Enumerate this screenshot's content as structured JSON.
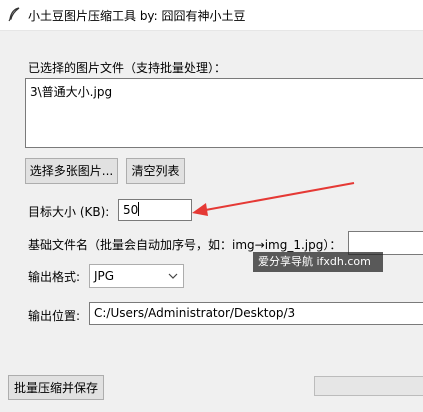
{
  "window": {
    "title": "小土豆图片压缩工具 by: 囧囧有神小土豆"
  },
  "files": {
    "label": "已选择的图片文件（支持批量处理）：",
    "items": [
      "3\\普通大小.jpg"
    ],
    "select_button": "选择多张图片...",
    "clear_button": "清空列表"
  },
  "target_size": {
    "label": "目标大小 (KB):",
    "value": "50"
  },
  "base_name": {
    "label": "基础文件名（批量会自动加序号，如：img→img_1.jpg）：",
    "value": ""
  },
  "watermark": "爱分享导航 ifxdh.com",
  "format": {
    "label": "输出格式:",
    "selected": "JPG"
  },
  "output": {
    "label": "输出位置:",
    "value": "C:/Users/Administrator/Desktop/3"
  },
  "action": {
    "compress_button": "批量压缩并保存"
  },
  "progress": {
    "value": 0
  },
  "colors": {
    "annotation_arrow": "#e53935",
    "progress_fill": "#06b025"
  }
}
